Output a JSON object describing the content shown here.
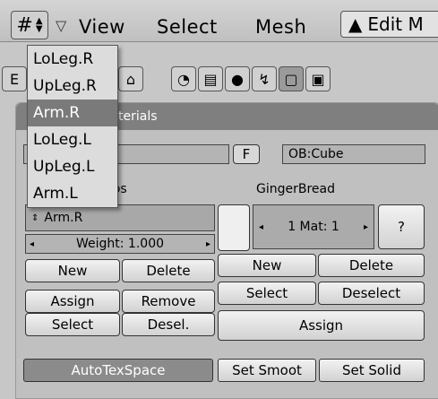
{
  "header": {
    "menu_icon": "grid-icon",
    "items": [
      "View",
      "Select",
      "Mesh"
    ],
    "mode_label": "Edit M",
    "mode_icon": "edit-mode-icon"
  },
  "left_partial": "E",
  "popup": {
    "items": [
      "LoLeg.R",
      "UpLeg.R",
      "Arm.R",
      "LoLeg.L",
      "UpLeg.L",
      "Arm.L"
    ],
    "active_index": 2
  },
  "panel": {
    "header_partial": "d Materials",
    "mesh_partial": "e",
    "f_label": "F",
    "ob_label": "OB:Cube",
    "vg_label_partial": "oups",
    "mat_name": "GingerBread",
    "vgroup_value": "Arm.R",
    "weight": "Weight: 1.000",
    "mat_index": "1 Mat: 1",
    "question": "?",
    "left_buttons": {
      "new": "New",
      "delete": "Delete",
      "assign": "Assign",
      "remove": "Remove",
      "select": "Select",
      "desel": "Desel."
    },
    "right_buttons": {
      "new": "New",
      "delete": "Delete",
      "select": "Select",
      "deselect": "Deselect",
      "assign": "Assign"
    },
    "autotex": "AutoTexSpace",
    "set_smooth": "Set Smoot",
    "set_solid": "Set Solid"
  }
}
